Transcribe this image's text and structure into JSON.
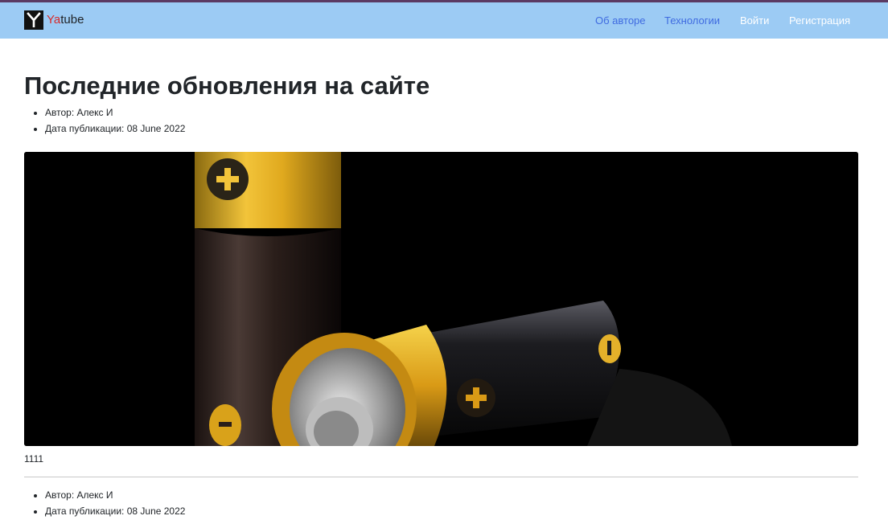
{
  "colors": {
    "navbar_bg": "#9ccbf4",
    "top_strip": "#5b3a63",
    "brand_accent": "#d62b2b",
    "link_blue": "#3f6be0",
    "link_white": "#ffffff"
  },
  "brand": {
    "accent": "Ya",
    "rest": "tube",
    "logo_icon": "yatube-logo-icon"
  },
  "nav": {
    "about": "Об авторе",
    "tech": "Технологии",
    "login": "Войти",
    "signup": "Регистрация"
  },
  "page": {
    "title": "Последние обновления на сайте"
  },
  "posts": [
    {
      "author": "Автор: Алекс И",
      "date": "Дата публикации: 08 June 2022",
      "image_icon": "batteries-image",
      "text": "1111"
    },
    {
      "author": "Автор: Алекс И",
      "date": "Дата публикации: 08 June 2022"
    }
  ]
}
